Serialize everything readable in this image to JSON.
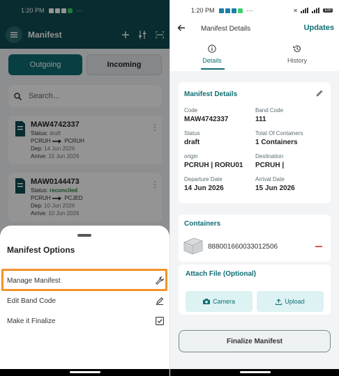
{
  "left": {
    "status_time": "1:20 PM",
    "status_dots": "···",
    "battery": "100",
    "app_title": "Manifest",
    "tabs": {
      "outgoing": "Outgoing",
      "incoming": "Incoming"
    },
    "search_placeholder": "Search...",
    "manifests": [
      {
        "code": "MAW4742337",
        "status_label": "Status:",
        "status": "draft",
        "from": "PCRUH",
        "to": "PCRUH",
        "dep_label": "Dep:",
        "dep": "14 Jun 2026",
        "arrive_label": "Arrive:",
        "arrive": "15 Jun 2026"
      },
      {
        "code": "MAW0144473",
        "status_label": "Status:",
        "status": "reconciled",
        "from": "PCRUH",
        "to": "PCJED",
        "dep_label": "Dep:",
        "dep": "10 Jun 2026",
        "arrive_label": "Arrive:",
        "arrive": "10 Jun 2026"
      }
    ],
    "sheet": {
      "title": "Manifest Options",
      "options": [
        {
          "label": "Manage Manifest",
          "icon": "wrench-icon"
        },
        {
          "label": "Edit Band Code",
          "icon": "pencil-icon"
        },
        {
          "label": "Make it Finalize",
          "icon": "checkbox-icon"
        }
      ]
    },
    "colors": {
      "primary": "#0f4c52",
      "accent": "#0f6d74",
      "highlight": "#f2922b"
    }
  },
  "right": {
    "status_time": "1:20 PM",
    "status_dots": "···",
    "battery": "100",
    "title": "Manifest Details",
    "updates": "Updates",
    "tabs": {
      "details": "Details",
      "history": "History"
    },
    "details": {
      "title": "Manifest Details",
      "code_label": "Code",
      "code": "MAW4742337",
      "band_label": "Band Code",
      "band": "111",
      "status_label": "Status",
      "status": "draft",
      "total_label": "Total Of Containers",
      "total": "1 Containers",
      "origin_label": "origin",
      "origin": "PCRUH | RORU01",
      "dest_label": "Destination",
      "dest": "PCRUH |",
      "dep_label": "Departure Date",
      "dep": "14 Jun 2026",
      "arr_label": "Arrival Date",
      "arr": "15 Jun 2026"
    },
    "containers": {
      "title": "Containers",
      "item": "888001660033012506"
    },
    "attach": {
      "title": "Attach File (Optional)",
      "camera": "Camera",
      "upload": "Upload"
    },
    "finalize": "Finalize Manifest"
  }
}
